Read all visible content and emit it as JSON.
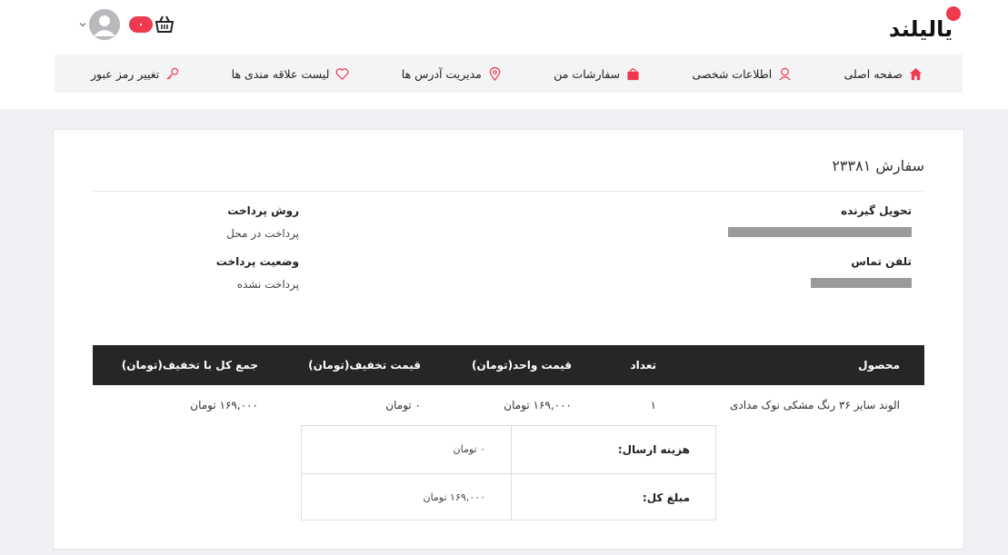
{
  "header": {
    "logo_text": "یالیلند",
    "cart_count": "۰",
    "icons": {
      "avatar": "user-avatar-icon",
      "cart": "basket-icon",
      "chevron": "chevron-down-icon"
    }
  },
  "nav": {
    "items": [
      {
        "label": "صفحه اصلی",
        "icon": "home-icon"
      },
      {
        "label": "اطلاعات شخصی",
        "icon": "user-icon"
      },
      {
        "label": "سفارشات من",
        "icon": "bag-icon"
      },
      {
        "label": "مدیریت آدرس ها",
        "icon": "location-pin-icon"
      },
      {
        "label": "لیست علاقه مندی ها",
        "icon": "heart-icon"
      },
      {
        "label": "تغییر رمز عبور",
        "icon": "key-icon"
      }
    ]
  },
  "order": {
    "title": "سفارش ۲۳۳۸۱",
    "recipient_label": "تحویل گیرنده",
    "phone_label": "تلفن تماس",
    "payment_method_label": "روش پرداخت",
    "payment_method_value": "پرداخت در محل",
    "payment_status_label": "وضعیت پرداخت",
    "payment_status_value": "پرداخت نشده"
  },
  "table": {
    "headers": {
      "product": "محصول",
      "quantity": "تعداد",
      "unit_price": "قیمت واحد(تومان)",
      "discount": "قیمت تخفیف(تومان)",
      "total": "جمع کل با تخفیف(تومان)"
    },
    "rows": [
      {
        "product": "الوند سایز ۳۶ رنگ مشکی نوک مدادی",
        "quantity": "۱",
        "unit_price": "۱۶۹,۰۰۰ تومان",
        "discount": "۰ تومان",
        "total": "۱۶۹,۰۰۰ تومان"
      }
    ]
  },
  "summary": {
    "shipping_label": "هزینه ارسال:",
    "shipping_value": "۰ تومان",
    "total_label": "مبلغ کل:",
    "total_value": "۱۶۹,۰۰۰ تومان"
  },
  "colors": {
    "accent": "#ef394e",
    "table_header": "#262626",
    "nav_bg": "#f4f4f6"
  }
}
